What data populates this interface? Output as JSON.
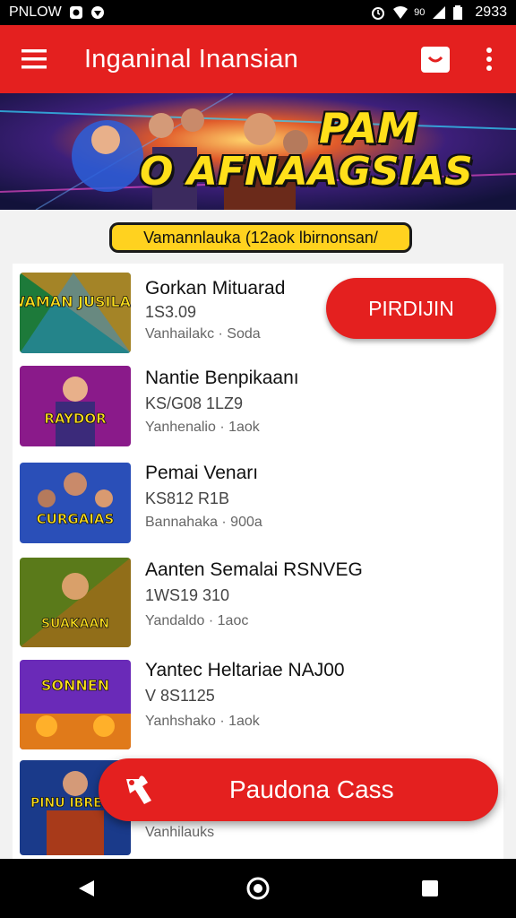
{
  "status_bar": {
    "left_text": "PNLOW",
    "right_text": "2933",
    "signal_text": "90",
    "icons": [
      "notification-icon",
      "location-icon",
      "alarm-icon",
      "wifi-icon",
      "signal-icon",
      "battery-icon"
    ]
  },
  "app_bar": {
    "title": "Inganinal Inansian",
    "menu_icon": "hamburger-menu-icon",
    "bag_icon": "shopping-bag-icon",
    "more_icon": "more-vert-icon"
  },
  "banner": {
    "line1": "PAM",
    "line2": "O AFNAAGSIAS"
  },
  "section_label": "Vamannlauka (12aok lbirnonsan/",
  "items": [
    {
      "title": "Gorkan Mituarad",
      "subtitle": "1S3.09",
      "meta": "Vanhailakc · Soda",
      "thumb_text": "WAMAN JUSILAS",
      "has_button": true,
      "button_label": "PIRDIJIN"
    },
    {
      "title": "Nantie Benpikaanı",
      "subtitle": "KS/G08 1LZ9",
      "meta": "Yanhenalio · 1aok",
      "thumb_text": "RAYDOR"
    },
    {
      "title": "Pemai Venarı",
      "subtitle": "KS812 R1B",
      "meta": "Bannahaka · 900a",
      "thumb_text": "CURGAIAS"
    },
    {
      "title": "Aanten Semalai RSNVEG",
      "subtitle": "1WS19 310",
      "meta": "Yandaldo · 1aoc",
      "thumb_text": "SUAKAAN"
    },
    {
      "title": "Yantec Heltariae NAJ00",
      "subtitle": "V 8S1125",
      "meta": "Yanhshako · 1aok",
      "thumb_text": "SONNEN"
    },
    {
      "title": "",
      "subtitle": "",
      "meta": "Vanhilauks",
      "thumb_text": "PINU IBREBE"
    }
  ],
  "fab": {
    "label": "Paudona Cass",
    "icon": "puzzle-pin-icon"
  },
  "nav": {
    "back_icon": "back-triangle-icon",
    "home_icon": "home-circle-icon",
    "recents_icon": "recents-square-icon"
  },
  "colors": {
    "primary": "#e4201f",
    "accent": "#ffd21f",
    "status_bg": "#000000"
  }
}
